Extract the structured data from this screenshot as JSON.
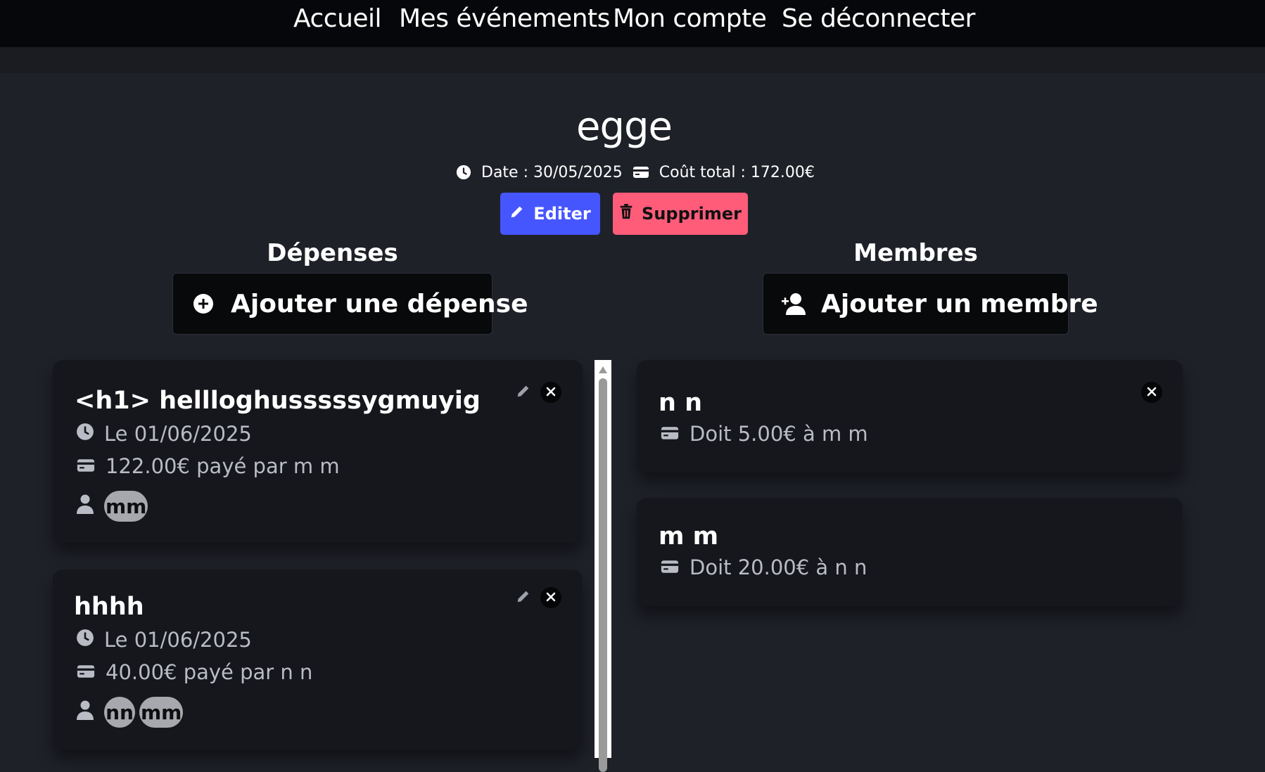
{
  "nav": {
    "items": [
      {
        "label": "Accueil"
      },
      {
        "label": "Mes événements"
      },
      {
        "label": "Mon compte"
      },
      {
        "label": "Se déconnecter"
      }
    ]
  },
  "event": {
    "title": "egge",
    "date_text": "Date : 30/05/2025",
    "total_text": "Coût total : 172.00€",
    "edit_label": "Editer",
    "delete_label": "Supprimer"
  },
  "expenses": {
    "heading": "Dépenses",
    "add_label": "Ajouter une dépense",
    "items": [
      {
        "title": "<h1> hellloghusssssygmuyig",
        "date": "Le 01/06/2025",
        "paid": "122.00€ payé par m m",
        "participants": [
          "mm"
        ]
      },
      {
        "title": "hhhh",
        "date": "Le 01/06/2025",
        "paid": "40.00€ payé par n n",
        "participants": [
          "nn",
          "mm"
        ]
      }
    ]
  },
  "members": {
    "heading": "Membres",
    "add_label": "Ajouter un membre",
    "items": [
      {
        "name": "n n",
        "balance": "Doit 5.00€ à m m"
      },
      {
        "name": "m m",
        "balance": "Doit 20.00€ à n n"
      }
    ]
  },
  "colors": {
    "primary": "#4656ff",
    "danger": "#ff5c7a",
    "background": "#1f2129",
    "card": "#15171c",
    "navbar": "#06070a"
  }
}
